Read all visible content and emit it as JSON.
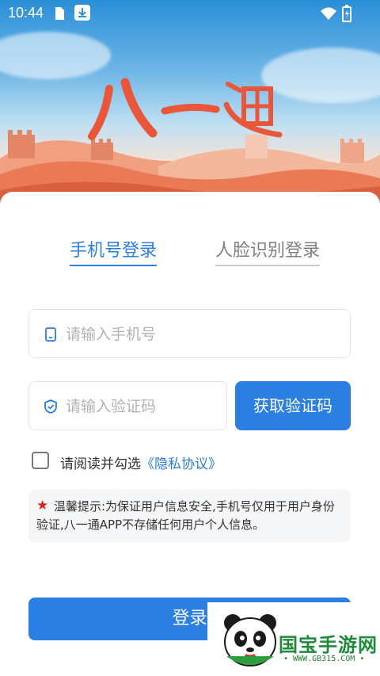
{
  "status_bar": {
    "time": "10:44",
    "icons": [
      "sim-card-icon",
      "download-icon",
      "wifi-icon",
      "battery-charging-icon"
    ]
  },
  "app": {
    "logo_text": "八一通"
  },
  "tabs": [
    {
      "label": "手机号登录",
      "active": true
    },
    {
      "label": "人脸识别登录",
      "active": false
    }
  ],
  "form": {
    "phone_placeholder": "请输入手机号",
    "code_placeholder": "请输入验证码",
    "get_code_label": "获取验证码",
    "agree_text": "请阅读并勾选",
    "agree_link": "《隐私协议》",
    "agree_checked": false
  },
  "tip": {
    "star": "★",
    "text": "温馨提示:为保证用户信息安全,手机号仅用于用户身份验证,八一通APP不存储任何用户个人信息。"
  },
  "login_button": "登录",
  "watermark": {
    "name": "国宝手游网",
    "url": "• WWW.GB315.COM •"
  },
  "colors": {
    "accent": "#2a7fe0",
    "star": "#e02020",
    "watermark_green": "#1e8a3a"
  }
}
